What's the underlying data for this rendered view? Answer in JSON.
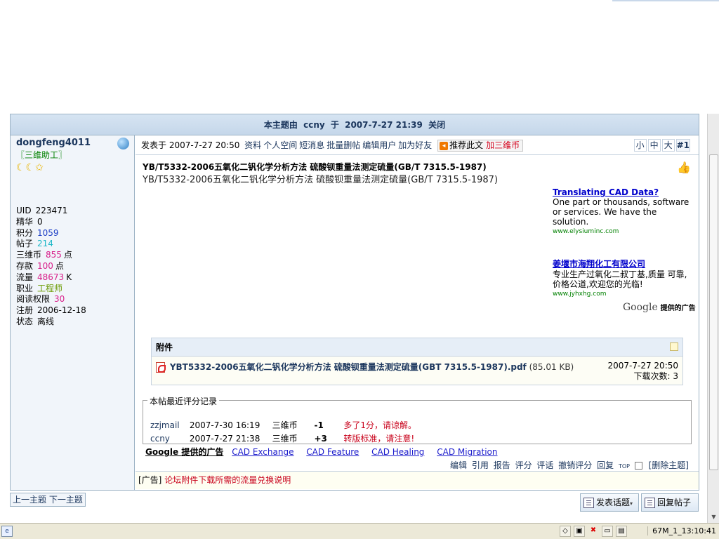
{
  "topic_closed": {
    "prefix": "本主题由",
    "user": "ccny",
    "mid": "于",
    "time": "2007-7-27 21:39",
    "suffix": "关闭"
  },
  "author": {
    "name": "dongfeng4011",
    "group": "〖三维助工〗",
    "stars": "☾☾✩",
    "stats": [
      {
        "label": "UID",
        "value": "223471",
        "unit": "",
        "color": "#000000"
      },
      {
        "label": "精华",
        "value": "0",
        "unit": "",
        "color": "#000000"
      },
      {
        "label": "积分",
        "value": "1059",
        "unit": "",
        "color": "#1c3ec5"
      },
      {
        "label": "帖子",
        "value": "214",
        "unit": "",
        "color": "#1bb7c7"
      },
      {
        "label": "三维币",
        "value": "855",
        "unit": "点",
        "color": "#d81f8a"
      },
      {
        "label": "存款",
        "value": "100",
        "unit": "点",
        "color": "#d81f8a"
      },
      {
        "label": "流量",
        "value": "48673",
        "unit": "K",
        "color": "#d81f8a"
      },
      {
        "label": "职业",
        "value": "工程师",
        "unit": "",
        "color": "#6a9a00"
      },
      {
        "label": "阅读权限",
        "value": "30",
        "unit": "",
        "color": "#d81f8a"
      },
      {
        "label": "注册",
        "value": "2006-12-18",
        "unit": "",
        "color": "#000000"
      },
      {
        "label": "状态",
        "value": "离线",
        "unit": "",
        "color": "#000000"
      }
    ]
  },
  "post_head": {
    "posted_prefix": "发表于",
    "posted_time": "2007-7-27 20:50",
    "links": [
      "资料",
      "个人空间",
      "短消息",
      "批量删帖",
      "编辑用户",
      "加为好友"
    ],
    "recommend": "推荐此文",
    "add_coin": "加三维币",
    "sizes": [
      "小",
      "中",
      "大"
    ],
    "floor": "#1"
  },
  "post": {
    "title": "YB/T5332-2006五氧化二钒化学分析方法 硫酸钡重量法测定硫量(GB/T 7315.5-1987)",
    "body": "YB/T5332-2006五氧化二钒化学分析方法  硫酸钡重量法测定硫量(GB/T 7315.5-1987)"
  },
  "ads": [
    {
      "title": "Translating CAD Data?",
      "text": "One part or thousands, software or services. We have the solution.",
      "url": "www.elysiuminc.com"
    },
    {
      "title": "姜堰市海翔化工有限公司",
      "text": "专业生产过氧化二叔丁基,质量 可靠,价格公道,欢迎您的光临!",
      "url": "www.jyhxhg.com"
    }
  ],
  "google_tag": {
    "brand": "Google",
    "text": "提供的广告"
  },
  "attachment": {
    "header": "附件",
    "filename": "YBT5332-2006五氧化二钒化学分析方法 硫酸钡重量法测定硫量(GBT 7315.5-1987).pdf",
    "size": "(85.01 KB)",
    "date": "2007-7-27 20:50",
    "downloads": "下载次数: 3"
  },
  "rating": {
    "legend": "本帖最近评分记录",
    "rows": [
      {
        "user": "zzjmail",
        "time": "2007-7-30 16:19",
        "currency": "三维币",
        "value": "-1",
        "note": "多了1分，请谅解。"
      },
      {
        "user": "ccny",
        "time": "2007-7-27 21:38",
        "currency": "三维币",
        "value": "+3",
        "note": "转版标准，请注意!"
      }
    ]
  },
  "google_links": {
    "label": "Google 提供的广告",
    "links": [
      "CAD Exchange",
      "CAD Feature",
      "CAD Healing",
      "CAD Migration"
    ]
  },
  "post_actions": [
    "编辑",
    "引用",
    "报告",
    "评分",
    "评话",
    "撤销评分",
    "回复"
  ],
  "top_label": "TOP",
  "delete_topic": "[删除主题]",
  "ad_line": {
    "prefix": "[广告]",
    "text": "论坛附件下载所需的流量兑换说明"
  },
  "nav": {
    "prev": "上一主题",
    "next": "下一主题"
  },
  "buttons": {
    "new_topic": "发表话题",
    "reply": "回复帖子"
  },
  "status": {
    "time": "67M_1_13:10:41"
  }
}
